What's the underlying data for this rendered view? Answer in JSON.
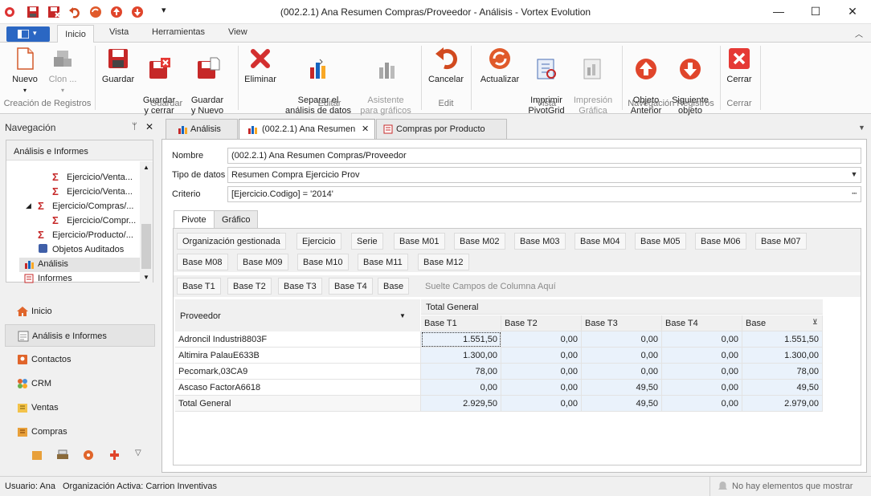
{
  "window": {
    "title": "(002.2.1) Ana Resumen Compras/Proveedor - Análisis - Vortex Evolution"
  },
  "ribbon_tabs": [
    "Inicio",
    "Vista",
    "Herramientas",
    "View"
  ],
  "ribbon": {
    "buttons": {
      "nuevo": "Nuevo",
      "clon": "Clon ...",
      "guardar": "Guardar",
      "guardar_cerrar": "Guardar\ny cerrar",
      "guardar_nuevo": "Guardar\ny Nuevo",
      "eliminar": "Eliminar",
      "separar": "Separar el\nanálisis de datos",
      "asistente": "Asistente\npara gráficos",
      "cancelar": "Cancelar",
      "actualizar": "Actualizar",
      "imprimir": "Imprimir\nPivotGrid",
      "impresion": "Impresión\nGráfica",
      "anterior": "Objeto\nAnterior",
      "siguiente": "Siguiente\nobjeto",
      "cerrar": "Cerrar"
    },
    "groups": {
      "creacion": "Creación de Registros",
      "guardar": "Guardar",
      "editar": "Editar",
      "edit": "Edit",
      "vista": "Vista",
      "navegacion": "Navegación Registros",
      "cerrar": "Cerrar"
    }
  },
  "nav": {
    "title": "Navegación",
    "section": "Análisis e Informes",
    "tree": [
      "Ejercicio/Venta...",
      "Ejercicio/Venta...",
      "Ejercicio/Compras/...",
      "Ejercicio/Compr...",
      "Ejercicio/Producto/...",
      "Objetos Auditados",
      "Análisis",
      "Informes"
    ],
    "modules": [
      "Inicio",
      "Análisis e Informes",
      "Contactos",
      "CRM",
      "Ventas",
      "Compras"
    ]
  },
  "doc_tabs": [
    "Análisis",
    "(002.2.1) Ana Resumen",
    "Compras por Producto"
  ],
  "form": {
    "nombre_label": "Nombre",
    "nombre_value": "(002.2.1) Ana Resumen Compras/Proveedor",
    "tipo_label": "Tipo de datos",
    "tipo_value": "Resumen Compra Ejercicio Prov",
    "criterio_label": "Criterio",
    "criterio_value": "[Ejercicio.Codigo] = '2014'"
  },
  "pivot_tabs": [
    "Pivote",
    "Gráfico"
  ],
  "pivot": {
    "filter_fields": [
      "Organización gestionada",
      "Ejercicio",
      "Serie",
      "Base M01",
      "Base M02",
      "Base M03",
      "Base M04",
      "Base M05",
      "Base M06",
      "Base M07",
      "Base M08",
      "Base M09",
      "Base M10",
      "Base M11",
      "Base M12"
    ],
    "data_fields": [
      "Base T1",
      "Base T2",
      "Base T3",
      "Base T4",
      "Base"
    ],
    "column_drop_hint": "Suelte Campos de Columna Aquí",
    "total_general_header": "Total General",
    "row_field": "Proveedor",
    "columns": [
      "Base T1",
      "Base T2",
      "Base T3",
      "Base T4",
      "Base"
    ],
    "rows": [
      {
        "name": "Adroncil Industri8803F",
        "values": [
          "1.551,50",
          "0,00",
          "0,00",
          "0,00",
          "1.551,50"
        ]
      },
      {
        "name": "Altimira PalauE633B",
        "values": [
          "1.300,00",
          "0,00",
          "0,00",
          "0,00",
          "1.300,00"
        ]
      },
      {
        "name": "Pecomark,03CA9",
        "values": [
          "78,00",
          "0,00",
          "0,00",
          "0,00",
          "78,00"
        ]
      },
      {
        "name": "Ascaso FactorA6618",
        "values": [
          "0,00",
          "0,00",
          "49,50",
          "0,00",
          "49,50"
        ]
      },
      {
        "name": "Total General",
        "values": [
          "2.929,50",
          "0,00",
          "49,50",
          "0,00",
          "2.979,00"
        ]
      }
    ]
  },
  "status": {
    "usuario": "Usuario: Ana",
    "organizacion": "Organización Activa: Carrion Inventivas",
    "notificaciones": "No hay elementos que mostrar"
  }
}
